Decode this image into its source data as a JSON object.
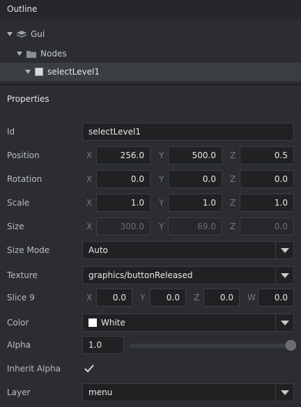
{
  "outline": {
    "title": "Outline",
    "tree": [
      {
        "label": "Gui",
        "icon": "gui-icon"
      },
      {
        "label": "Nodes",
        "icon": "folder-icon"
      },
      {
        "label": "selectLevel1",
        "icon": "box-icon",
        "selected": true
      }
    ]
  },
  "properties": {
    "title": "Properties",
    "id": {
      "label": "Id",
      "value": "selectLevel1"
    },
    "position": {
      "label": "Position",
      "x_axis": "X",
      "y_axis": "Y",
      "z_axis": "Z",
      "x": "256.0",
      "y": "500.0",
      "z": "0.5"
    },
    "rotation": {
      "label": "Rotation",
      "x_axis": "X",
      "y_axis": "Y",
      "z_axis": "Z",
      "x": "0.0",
      "y": "0.0",
      "z": "0.0"
    },
    "scale": {
      "label": "Scale",
      "x_axis": "X",
      "y_axis": "Y",
      "z_axis": "Z",
      "x": "1.0",
      "y": "1.0",
      "z": "1.0"
    },
    "size": {
      "label": "Size",
      "x_axis": "X",
      "y_axis": "Y",
      "z_axis": "Z",
      "x": "300.0",
      "y": "69.0",
      "z": "0.0"
    },
    "size_mode": {
      "label": "Size Mode",
      "value": "Auto"
    },
    "texture": {
      "label": "Texture",
      "value": "graphics/buttonReleased"
    },
    "slice9": {
      "label": "Slice 9",
      "x_axis": "X",
      "y_axis": "Y",
      "z_axis": "Z",
      "w_axis": "W",
      "x": "0.0",
      "y": "0.0",
      "z": "0.0",
      "w": "0.0"
    },
    "color": {
      "label": "Color",
      "value": "White",
      "swatch": "#ffffff"
    },
    "alpha": {
      "label": "Alpha",
      "value": "1.0",
      "slider_level": 1.0
    },
    "inherit_alpha": {
      "label": "Inherit Alpha",
      "checked": true
    },
    "layer": {
      "label": "Layer",
      "value": "menu"
    }
  }
}
